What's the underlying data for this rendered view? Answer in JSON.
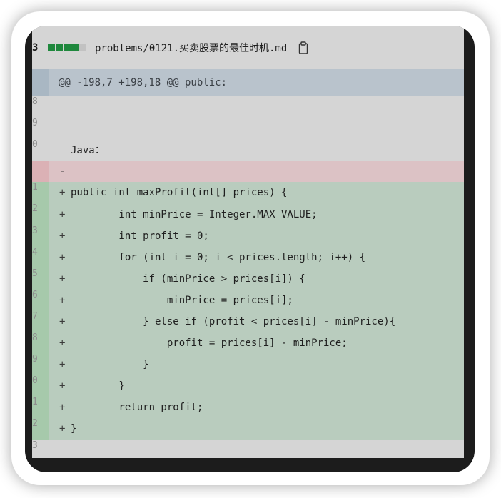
{
  "file_header": {
    "change_count": "3",
    "diffstat": [
      "add",
      "add",
      "add",
      "add",
      "neutral"
    ],
    "path": "problems/0121.买卖股票的最佳时机.md",
    "copy_icon": "clipboard-icon"
  },
  "hunk": {
    "header": "@@ -198,7 +198,18 @@ public:"
  },
  "lines": [
    {
      "type": "context",
      "num": "8",
      "sign": "",
      "code": ""
    },
    {
      "type": "context",
      "num": "9",
      "sign": "",
      "code": ""
    },
    {
      "type": "context",
      "num": "0",
      "sign": "",
      "code": "Java："
    },
    {
      "type": "del",
      "num": "",
      "sign": "-",
      "code": ""
    },
    {
      "type": "add",
      "num": "1",
      "sign": "+",
      "code": "public int maxProfit(int[] prices) {"
    },
    {
      "type": "add",
      "num": "2",
      "sign": "+",
      "code": "        int minPrice = Integer.MAX_VALUE;"
    },
    {
      "type": "add",
      "num": "3",
      "sign": "+",
      "code": "        int profit = 0;"
    },
    {
      "type": "add",
      "num": "4",
      "sign": "+",
      "code": "        for (int i = 0; i < prices.length; i++) {"
    },
    {
      "type": "add",
      "num": "5",
      "sign": "+",
      "code": "            if (minPrice > prices[i]) {"
    },
    {
      "type": "add",
      "num": "6",
      "sign": "+",
      "code": "                minPrice = prices[i];"
    },
    {
      "type": "add",
      "num": "7",
      "sign": "+",
      "code": "            } else if (profit < prices[i] - minPrice){"
    },
    {
      "type": "add",
      "num": "8",
      "sign": "+",
      "code": "                profit = prices[i] - minPrice;"
    },
    {
      "type": "add",
      "num": "9",
      "sign": "+",
      "code": "            }"
    },
    {
      "type": "add",
      "num": "0",
      "sign": "+",
      "code": "        }"
    },
    {
      "type": "add",
      "num": "1",
      "sign": "+",
      "code": "        return profit;"
    },
    {
      "type": "add",
      "num": "2",
      "sign": "+",
      "code": "}"
    },
    {
      "type": "context",
      "num": "3",
      "sign": "",
      "code": ""
    }
  ],
  "colors": {
    "added_bg": "#b9ccbe",
    "deleted_bg": "#dcc2c5",
    "hunk_bg": "#b9c3cc",
    "diffstat_add": "#1f883d"
  }
}
